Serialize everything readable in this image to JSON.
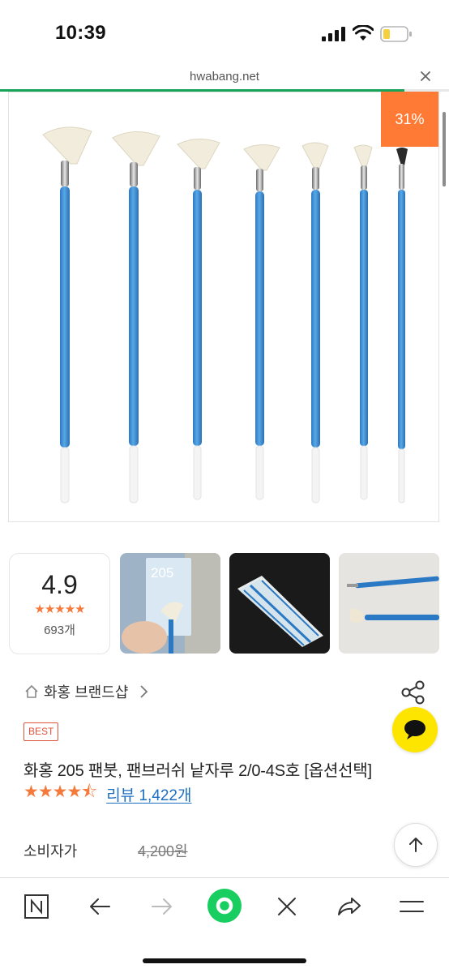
{
  "status_bar": {
    "time": "10:39"
  },
  "browser": {
    "url": "hwabang.net",
    "load_progress": 0.9
  },
  "product_image": {
    "discount_badge": "31%"
  },
  "rating_card": {
    "score": "4.9",
    "stars": "★★★★★",
    "count": "693개"
  },
  "thumbnails": [
    {
      "label": "205"
    },
    {
      "label": ""
    },
    {
      "label": ""
    }
  ],
  "brand": {
    "name": "화홍 브랜드샵"
  },
  "product": {
    "badge": "BEST",
    "title": "화홍 205 팬붓, 팬브러쉬 낱자루 2/0-4S호 [옵션선택]",
    "rating_stars": 4.5,
    "review_link": "리뷰 1,422개"
  },
  "price": {
    "consumer_label": "소비자가",
    "consumer_value": "4,200원"
  },
  "colors": {
    "accent_green": "#18a35a",
    "discount_orange": "#ff7a34",
    "star_orange": "#f5793b",
    "link_blue": "#1d6fc2",
    "kakao_yellow": "#fee500"
  },
  "toolbar": {
    "icons": [
      "naver-n-icon",
      "back-arrow-icon",
      "forward-arrow-icon",
      "green-dot-icon",
      "close-icon",
      "share-icon",
      "menu-icon"
    ]
  }
}
